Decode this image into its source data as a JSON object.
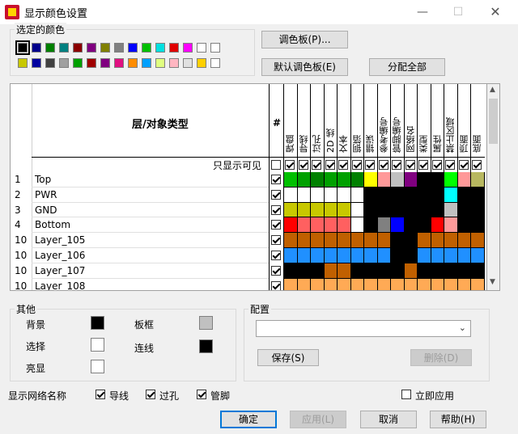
{
  "window": {
    "title": "显示颜色设置",
    "app_icon_text": "PADS"
  },
  "selected_colors": {
    "label": "选定的颜色",
    "swatches": [
      "#000000",
      "#00008b",
      "#008000",
      "#008080",
      "#8b0000",
      "#800080",
      "#808000",
      "#808080",
      "#0000ff",
      "#00c000",
      "#00e0e0",
      "#e00000",
      "#ff00ff",
      "#ffffff",
      "#ffffff",
      "#c8c800",
      "#0000a0",
      "#404040",
      "#a0a0a0",
      "#00a000",
      "#a00000",
      "#800080",
      "#e01080",
      "#ff8c00",
      "#00a0ff",
      "#e0ff80",
      "#ffb6c1",
      "#e0e0e0",
      "#ffd000",
      "#ffffff"
    ]
  },
  "buttons": {
    "palette": "调色板(P)...",
    "default_palette": "默认调色板(E)",
    "assign_all": "分配全部",
    "save": "保存(S)",
    "delete": "删除(D)",
    "ok": "确定",
    "apply": "应用(L)",
    "cancel": "取消",
    "help": "帮助(H)"
  },
  "table": {
    "type_header": "层/对象类型",
    "hash_header": "#",
    "show_visible_label": "只显示可见",
    "columns": [
      "焊盘",
      "导线",
      "过孔",
      "2D 线",
      "文本",
      "铜箔",
      "错误",
      "参考编号",
      "管脚编号",
      "网络名",
      "类型",
      "属性",
      "禁止区域",
      "顶面",
      "底面"
    ],
    "rows": [
      {
        "num": "1",
        "name": "Top",
        "colors": [
          "#00c000",
          "#00a000",
          "#008000",
          "#00a000",
          "#00a000",
          "#008000",
          "#ffff00",
          "#ff9999",
          "#c0c0c0",
          "#800080",
          "#000000",
          "#000000",
          "#00ff00",
          "#ff9999",
          "#b8b860"
        ]
      },
      {
        "num": "2",
        "name": "PWR",
        "colors": [
          "#ffffff",
          "#ffffff",
          "#ffffff",
          "#ffffff",
          "#ffffff",
          "#ffffff",
          "#000000",
          "#000000",
          "#000000",
          "#000000",
          "#000000",
          "#000000",
          "#00ffff",
          "#000000",
          "#000000"
        ]
      },
      {
        "num": "3",
        "name": "GND",
        "colors": [
          "#c8c800",
          "#c8c800",
          "#c8c800",
          "#c8c800",
          "#c8c800",
          "#ffffff",
          "#000000",
          "#000000",
          "#000000",
          "#000000",
          "#000000",
          "#000000",
          "#c0c0c0",
          "#000000",
          "#000000"
        ]
      },
      {
        "num": "4",
        "name": "Bottom",
        "colors": [
          "#ff0000",
          "#ff6060",
          "#ff6060",
          "#ff6060",
          "#ff6060",
          "#ffffff",
          "#000000",
          "#808080",
          "#0000ff",
          "#000000",
          "#000000",
          "#ff0000",
          "#ff9999",
          "#000000",
          "#000000"
        ]
      },
      {
        "num": "10",
        "name": "Layer_105",
        "colors": [
          "#c06000",
          "#c06000",
          "#c06000",
          "#c06000",
          "#c06000",
          "#c06000",
          "#c06000",
          "#c06000",
          "#000000",
          "#000000",
          "#c06000",
          "#c06000",
          "#c06000",
          "#c06000",
          "#c06000"
        ]
      },
      {
        "num": "10",
        "name": "Layer_106",
        "colors": [
          "#2090ff",
          "#2090ff",
          "#2090ff",
          "#2090ff",
          "#2090ff",
          "#2090ff",
          "#2090ff",
          "#2090ff",
          "#000000",
          "#000000",
          "#2090ff",
          "#2090ff",
          "#2090ff",
          "#2090ff",
          "#2090ff"
        ]
      },
      {
        "num": "10",
        "name": "Layer_107",
        "colors": [
          "#000000",
          "#000000",
          "#000000",
          "#c06000",
          "#c06000",
          "#000000",
          "#000000",
          "#000000",
          "#000000",
          "#c06000",
          "#000000",
          "#000000",
          "#000000",
          "#000000",
          "#000000"
        ]
      },
      {
        "num": "10",
        "name": "Layer_108",
        "colors": [
          "#ffaa55",
          "#ffaa55",
          "#ffaa55",
          "#ffaa55",
          "#ffaa55",
          "#ffaa55",
          "#ffaa55",
          "#ffaa55",
          "#ffaa55",
          "#ffaa55",
          "#ffaa55",
          "#ffaa55",
          "#ffaa55",
          "#ffaa55",
          "#ffaa55"
        ]
      }
    ]
  },
  "other": {
    "label": "其他",
    "background": "背景",
    "selection": "选择",
    "highlight": "亮显",
    "board_frame": "板框",
    "connection": "连线",
    "colors": {
      "background": "#000000",
      "selection": "#ffffff",
      "highlight": "#ffffff",
      "board_frame": "#c0c0c0",
      "connection": "#000000"
    }
  },
  "config": {
    "label": "配置",
    "selected": ""
  },
  "netnames": {
    "label": "显示网络名称",
    "traces": "导线",
    "vias": "过孔",
    "pins": "管脚",
    "apply_now": "立即应用"
  }
}
